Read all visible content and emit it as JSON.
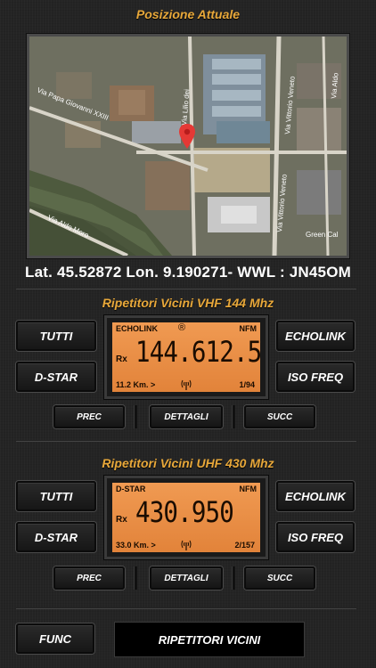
{
  "position": {
    "title": "Posizione Attuale",
    "coords": "Lat. 45.52872 Lon. 9.190271- WWL : JN45OM",
    "map_labels": {
      "street1": "Via Papa Giovanni XXIII",
      "street2": "Via Aldo Moro",
      "street3": "Via Vittorio Veneto",
      "street4": "Via Vittorio Veneto",
      "street5": "Via Aldo",
      "street6": "Via Lilio dei",
      "place1": "Green Cal"
    }
  },
  "vhf": {
    "title": "Ripetitori Vicini VHF 144 Mhz",
    "buttons": {
      "tutti": "TUTTI",
      "dstar": "D-STAR",
      "echolink": "ECHOLINK",
      "isofreq": "ISO FREQ",
      "prec": "PREC",
      "dettagli": "DETTAGLI",
      "succ": "SUCC"
    },
    "lcd": {
      "mode": "ECHOLINK",
      "reg": "®",
      "modulation": "NFM",
      "rx": "Rx",
      "freq": "144.612.5",
      "distance": "11.2 Km. >",
      "index": "1/94"
    }
  },
  "uhf": {
    "title": "Ripetitori Vicini UHF 430 Mhz",
    "buttons": {
      "tutti": "TUTTI",
      "dstar": "D-STAR",
      "echolink": "ECHOLINK",
      "isofreq": "ISO FREQ",
      "prec": "PREC",
      "dettagli": "DETTAGLI",
      "succ": "SUCC"
    },
    "lcd": {
      "mode": "D-STAR",
      "modulation": "NFM",
      "rx": "Rx",
      "freq": "430.950",
      "distance": "33.0 Km. >",
      "index": "2/157"
    }
  },
  "footer": {
    "func": "FUNC",
    "display": "RIPETITORI VICINI"
  },
  "colors": {
    "accent": "#e8a83a",
    "lcd": "#ec8f45",
    "pin": "#e53935"
  }
}
